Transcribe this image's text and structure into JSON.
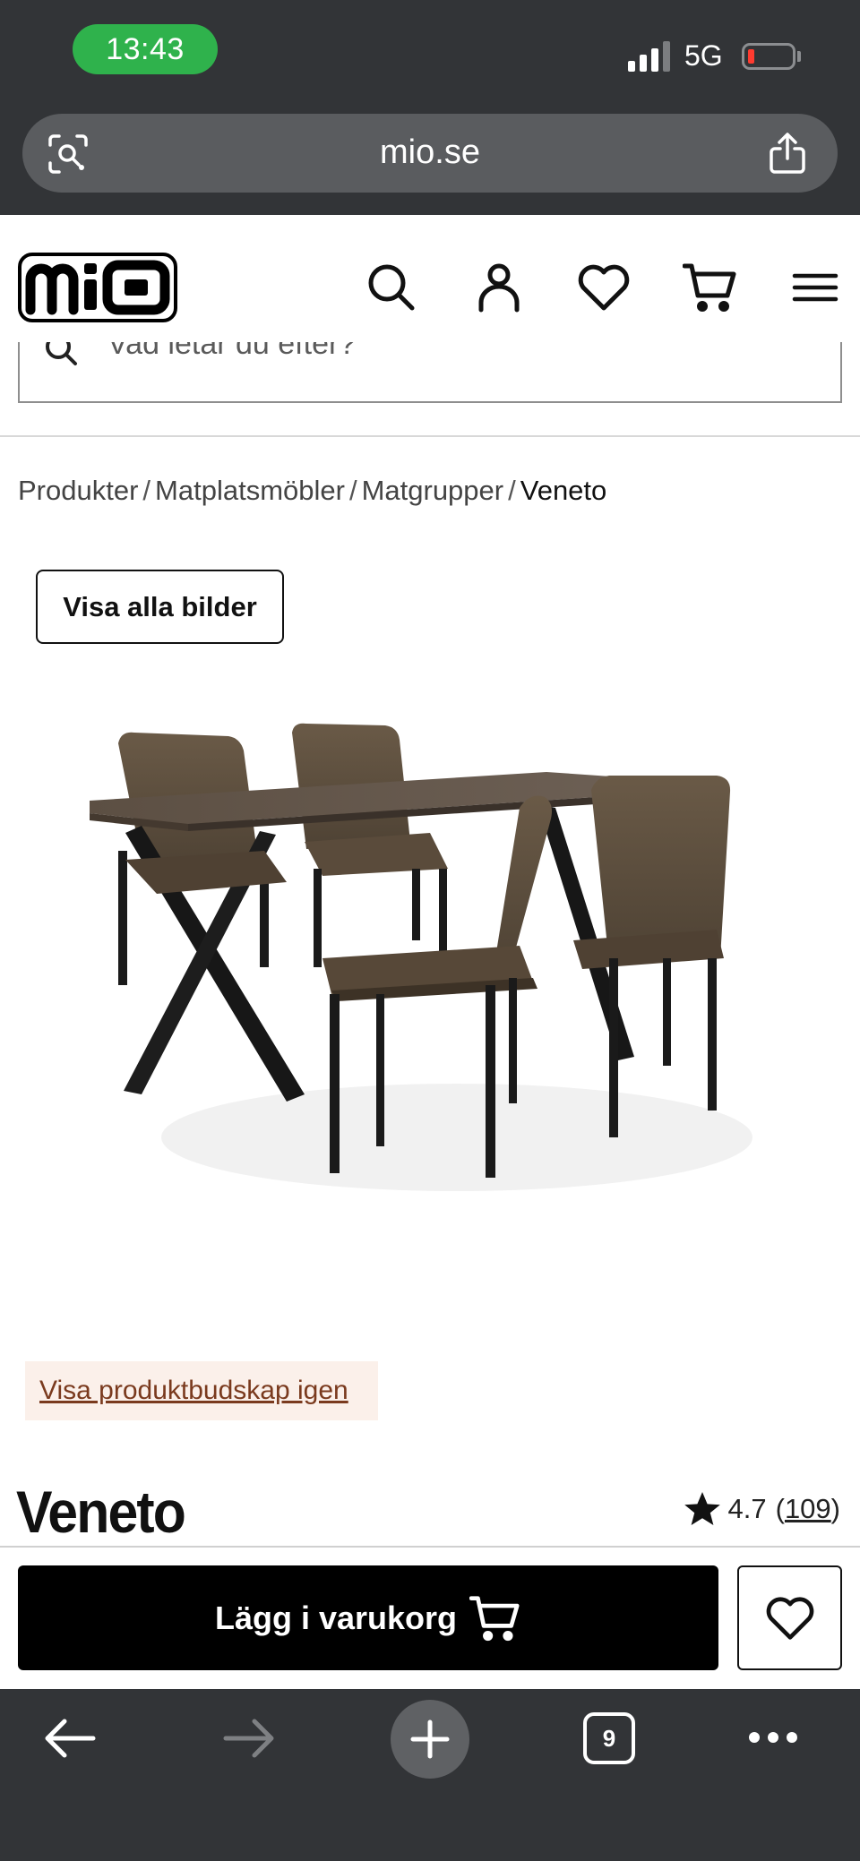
{
  "status_bar": {
    "time": "13:43",
    "network": "5G"
  },
  "browser": {
    "url": "mio.se",
    "tab_count": "9"
  },
  "site": {
    "logo_text": "mio",
    "search_placeholder": "Vad letar du efter?"
  },
  "breadcrumb": [
    "Produkter",
    "Matplatsmöbler",
    "Matgrupper",
    "Veneto"
  ],
  "gallery": {
    "view_all_label": "Visa alla bilder"
  },
  "product": {
    "message_link": "Visa produktbudskap igen",
    "title": "Veneto",
    "rating": "4.7",
    "review_count": "109"
  },
  "actions": {
    "add_to_cart_label": "Lägg i varukorg"
  },
  "colors": {
    "browser_chrome": "#323437",
    "time_pill": "#2fb24c",
    "primary_button": "#000000",
    "message_bg": "#fbf0ea",
    "message_link": "#7a3a1e"
  },
  "icons": [
    "camera-search-icon",
    "share-icon",
    "search-icon",
    "account-icon",
    "heart-icon",
    "cart-icon",
    "menu-icon",
    "star-icon",
    "back-arrow-icon",
    "forward-arrow-icon",
    "new-tab-plus-icon",
    "tabs-icon",
    "more-icon"
  ]
}
